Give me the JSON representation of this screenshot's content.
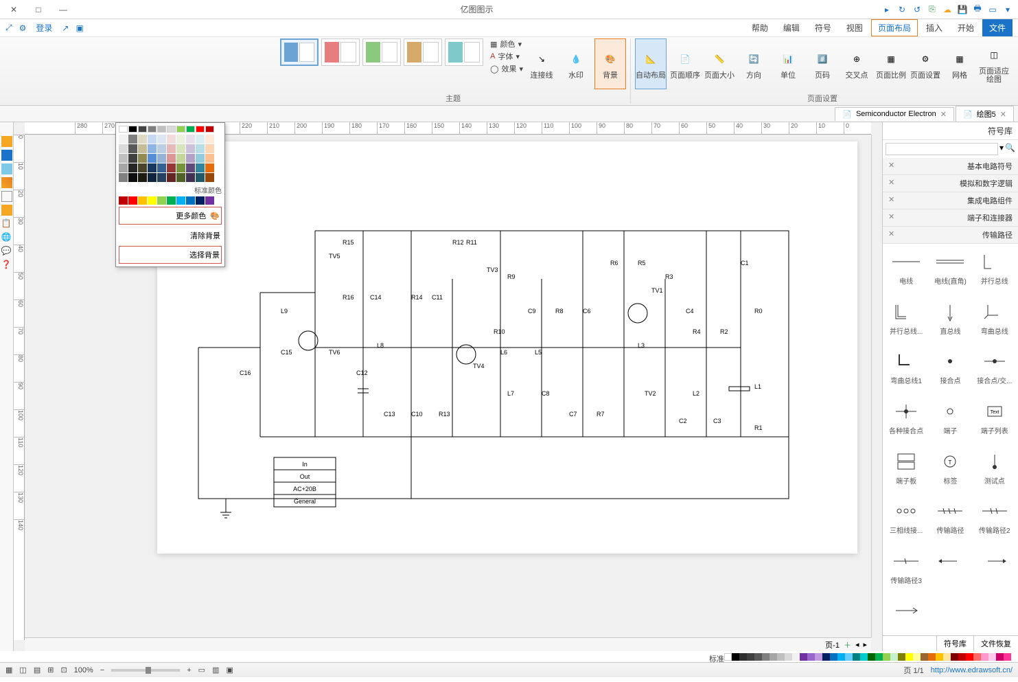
{
  "title": "亿图图示",
  "menu": {
    "file": "文件",
    "start": "开始",
    "insert": "插入",
    "pagelayout": "页面布局",
    "view": "视图",
    "symbols": "符号",
    "edit": "编辑",
    "help": "帮助",
    "login": "登录"
  },
  "ribbon": {
    "group_pagesetup": "页面设置",
    "group_theme": "主题",
    "buttons": {
      "auto_layout": "自动布局",
      "page_order": "页面顺序",
      "page_size": "页面大小",
      "orientation": "方向",
      "unit": "单位",
      "page_number": "页码",
      "cross_point": "交叉点",
      "page_margin": "页面比例",
      "page_setup": "页面设置",
      "grid": "网格",
      "snap_align": "页面适应绘图",
      "watermark": "水印",
      "background": "背景",
      "connector": "连接线",
      "theme_label": "主题",
      "opt_color": "颜色",
      "opt_font": "字体",
      "opt_effect": "效果"
    }
  },
  "doctabs": {
    "tab1": "绘图5",
    "tab2": "Semiconductor Electron"
  },
  "library": {
    "title": "符号库",
    "search_placeholder": "",
    "cats": {
      "c1": "基本电路符号",
      "c2": "模拟和数字逻辑",
      "c3": "集成电路组件",
      "c4": "端子和连接器",
      "c5": "传输路径"
    },
    "items": {
      "i1": "电线",
      "i2": "电线(直角)",
      "i3": "并行总线",
      "i4": "并行总线...",
      "i5": "直总线",
      "i6": "弯曲总线",
      "i7": "弯曲总线1",
      "i8": "接合点",
      "i9": "接合点/交...",
      "i10": "各种接合点",
      "i11": "端子",
      "i12": "端子列表",
      "i13": "端子板",
      "i14": "标签",
      "i15": "测试点",
      "i16": "三相线接...",
      "i17": "传输路径",
      "i18": "传输路径2",
      "i19": "传输路径3"
    }
  },
  "lib_tabs": {
    "t1": "符号库",
    "t2": "文件恢复"
  },
  "popup": {
    "std_label": "标准颜色",
    "more": "更多颜色",
    "clear": "清除背景",
    "choose": "选择背景"
  },
  "terminals": {
    "t1": "In",
    "t2": "Out",
    "t3": "AC+20B",
    "t4": "General"
  },
  "page_tab": "页-1",
  "colorstrip_label": "标准",
  "status": {
    "url": "http://www.edrawsoft.cn/",
    "pages": "页 1/1",
    "zoom": "100%"
  }
}
